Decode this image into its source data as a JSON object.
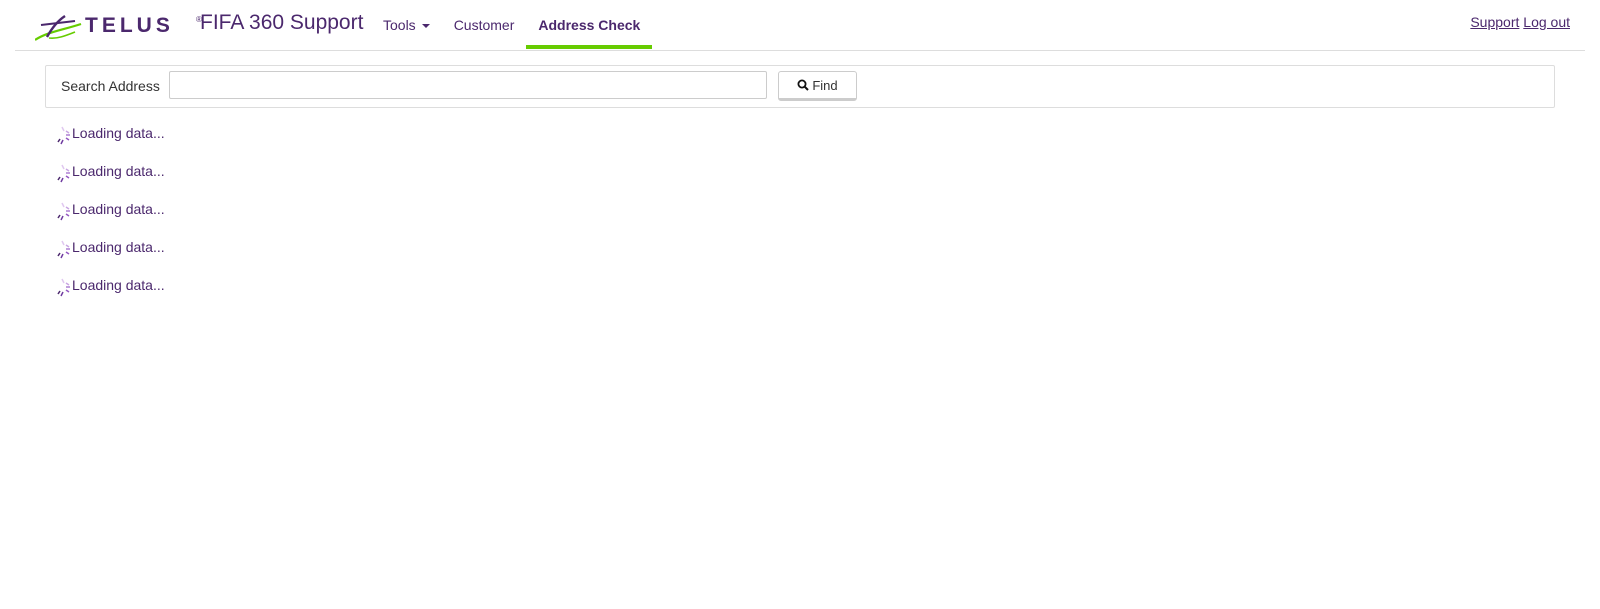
{
  "brand": {
    "logo_text": "TELUS",
    "logo_mark": "®",
    "app_title": "FIFA 360 Support",
    "purple": "#4b286d",
    "green": "#66cc00"
  },
  "nav": {
    "tools_label": "Tools",
    "customer_label": "Customer",
    "address_check_label": "Address Check",
    "active": "Address Check"
  },
  "top_links": {
    "support_label": "Support",
    "logout_label": "Log out"
  },
  "search": {
    "label": "Search Address",
    "value": "",
    "placeholder": "",
    "find_label": "Find",
    "find_icon": "search-icon"
  },
  "loading": {
    "items": [
      "Loading data...",
      "Loading data...",
      "Loading data...",
      "Loading data...",
      "Loading data..."
    ],
    "icon": "spinner-icon"
  }
}
